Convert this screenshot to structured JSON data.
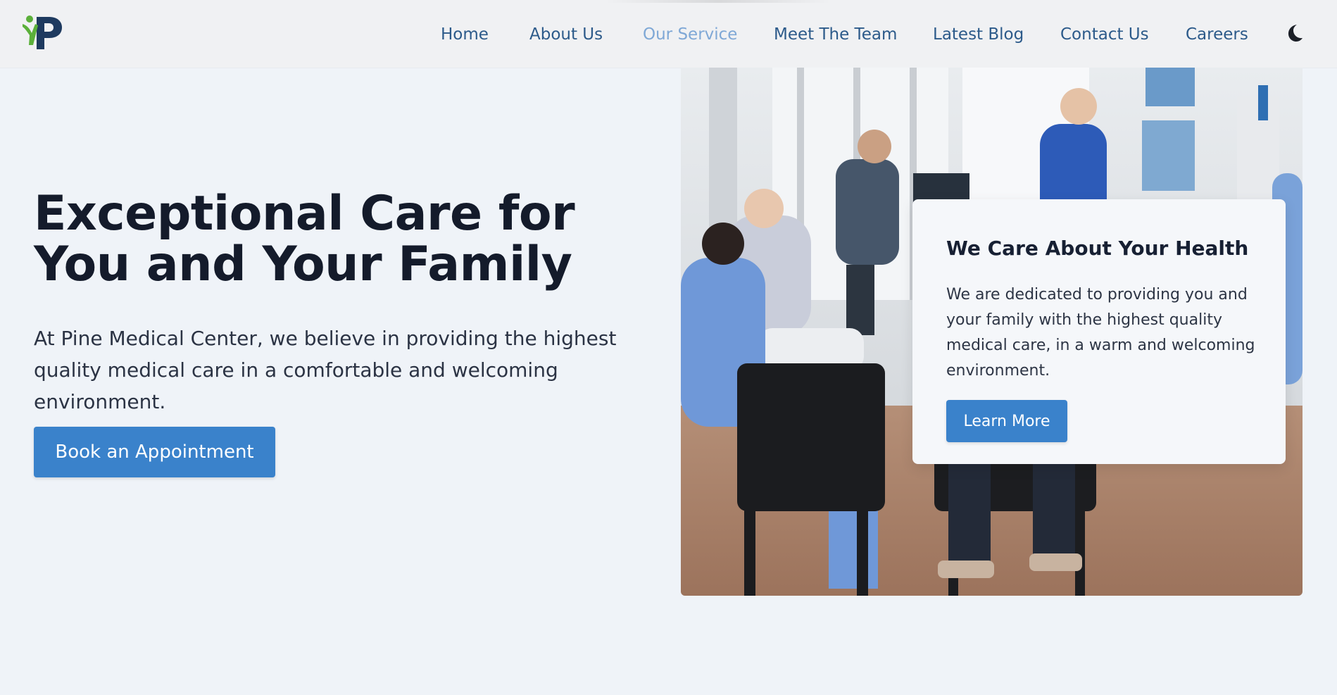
{
  "header": {
    "logo_icon": "pine-medical-logo",
    "nav": [
      {
        "label": "Home",
        "active": false
      },
      {
        "label": "About Us",
        "active": false
      },
      {
        "label": "Our Service",
        "active": true
      },
      {
        "label": "Meet The Team",
        "active": false
      },
      {
        "label": "Latest Blog",
        "active": false
      },
      {
        "label": "Contact Us",
        "active": false
      },
      {
        "label": "Careers",
        "active": false
      }
    ],
    "theme_toggle_icon": "moon-icon"
  },
  "hero": {
    "title_line1": "Exceptional Care for",
    "title_line2": "You and Your Family",
    "description": "At Pine Medical Center, we believe in providing the highest quality medical care in a comfortable and welcoming environment.",
    "cta_label": "Book an Appointment",
    "photo_subject": "clinic-waiting-room-photo"
  },
  "card": {
    "title": "We Care About Your Health",
    "text": "We are dedicated to providing you and your family with the highest quality medical care, in a warm and welcoming environment.",
    "button_label": "Learn More"
  },
  "colors": {
    "page_background": "#eff3f8",
    "header_background": "#f0f1f3",
    "nav_link": "#2c5a8a",
    "nav_link_active": "#7fa8d6",
    "button": "#3a82cb",
    "heading": "#141b2b",
    "logo_green": "#5bb03a",
    "logo_navy": "#1e3a5f"
  }
}
